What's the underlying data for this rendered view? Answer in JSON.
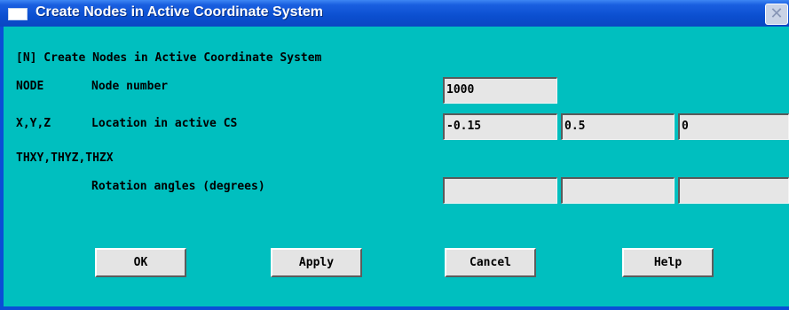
{
  "window": {
    "title": "Create Nodes in Active Coordinate System",
    "close_glyph": "✕"
  },
  "form": {
    "header": "[N]  Create Nodes in Active Coordinate System",
    "node": {
      "key": "NODE",
      "label": "Node number",
      "value": "1000"
    },
    "location": {
      "key": "X,Y,Z",
      "label": "Location in active CS",
      "x": "-0.15",
      "y": "0.5",
      "z": "0"
    },
    "rotation": {
      "key": "THXY,THYZ,THZX",
      "label": "Rotation angles (degrees)",
      "thxy": "",
      "thyz": "",
      "thzx": ""
    }
  },
  "buttons": {
    "ok": "OK",
    "apply": "Apply",
    "cancel": "Cancel",
    "help": "Help"
  },
  "colors": {
    "titlebar": "#0b4fd0",
    "client": "#00bfbf",
    "field": "#e6e6e6",
    "button": "#e4e4e4"
  }
}
